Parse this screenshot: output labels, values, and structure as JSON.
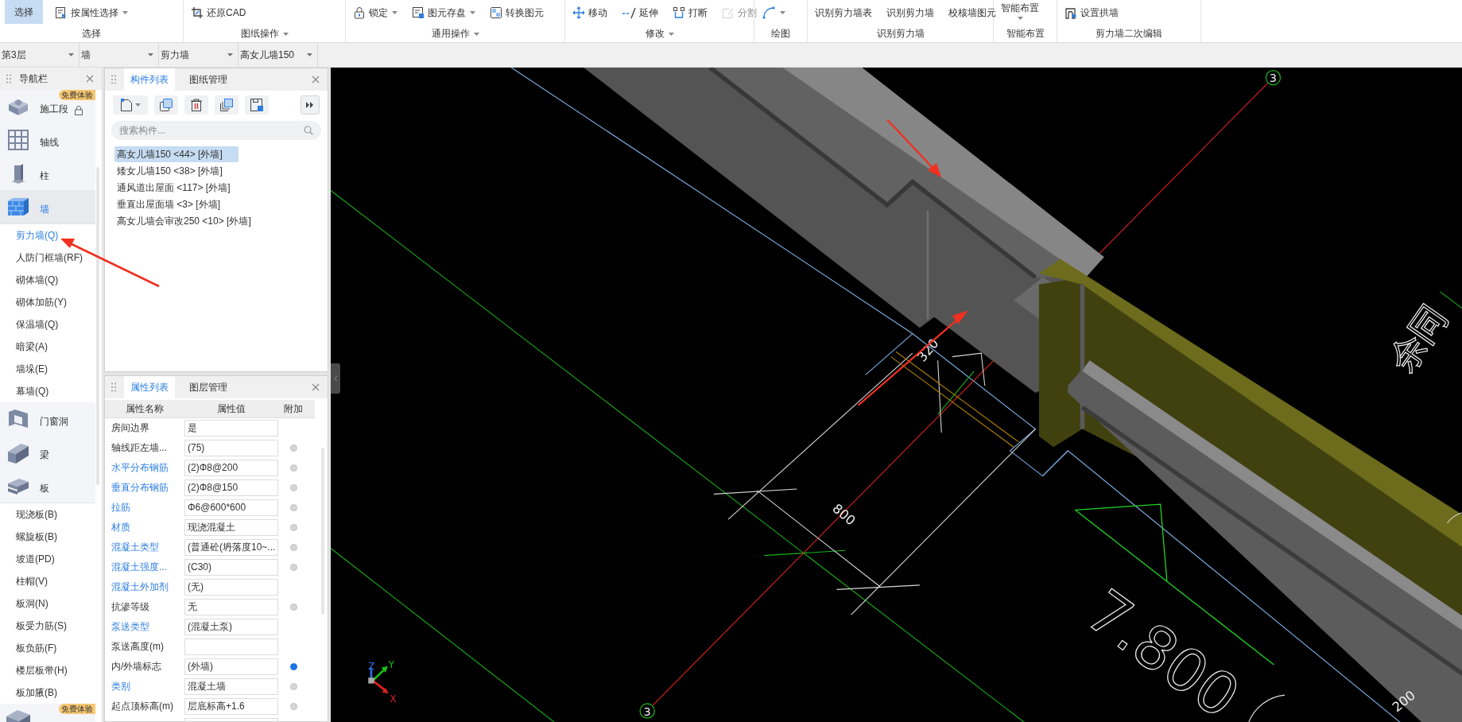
{
  "ribbon": {
    "groups": [
      {
        "label": "选择",
        "has_menu": false,
        "items": [
          {
            "kind": "big",
            "label": "选择",
            "selected": true,
            "disabled": false,
            "dropdown": false
          },
          {
            "kind": "small",
            "label": "按属性选择",
            "selected": false,
            "disabled": false,
            "dropdown": true
          }
        ]
      },
      {
        "label": "图纸操作",
        "has_menu": true,
        "items": [
          {
            "kind": "small",
            "label": "还原CAD",
            "selected": false,
            "disabled": false,
            "dropdown": false
          }
        ]
      },
      {
        "label": "通用操作",
        "has_menu": true,
        "items": [
          {
            "kind": "small",
            "label": "锁定",
            "selected": false,
            "disabled": false,
            "dropdown": true
          },
          {
            "kind": "small",
            "label": "图元存盘",
            "selected": false,
            "disabled": false,
            "dropdown": true
          },
          {
            "kind": "small",
            "label": "转换图元",
            "selected": false,
            "disabled": false,
            "dropdown": false
          }
        ]
      },
      {
        "label": "修改",
        "has_menu": true,
        "items": [
          {
            "kind": "small",
            "label": "移动",
            "selected": false,
            "disabled": false,
            "dropdown": false
          },
          {
            "kind": "small",
            "label": "延伸",
            "selected": false,
            "disabled": false,
            "dropdown": false
          },
          {
            "kind": "small",
            "label": "打断",
            "selected": false,
            "disabled": false,
            "dropdown": false
          },
          {
            "kind": "small",
            "label": "分割",
            "selected": false,
            "disabled": true,
            "dropdown": false
          }
        ]
      },
      {
        "label": "绘图",
        "has_menu": false,
        "items": [
          {
            "kind": "icon",
            "selected": false,
            "disabled": false,
            "dropdown": true
          }
        ]
      },
      {
        "label": "识别剪力墙",
        "has_menu": false,
        "items": [
          {
            "kind": "text",
            "label": "识别剪力墙表",
            "selected": false,
            "disabled": false,
            "dropdown": false
          },
          {
            "kind": "text",
            "label": "识别剪力墙",
            "selected": false,
            "disabled": false,
            "dropdown": false
          },
          {
            "kind": "text",
            "label": "校核墙图元",
            "selected": false,
            "disabled": false,
            "dropdown": false
          }
        ]
      },
      {
        "label": "智能布置",
        "has_menu": false,
        "items": [
          {
            "kind": "stacked",
            "label": "智能布置",
            "selected": false,
            "disabled": false,
            "dropdown": true
          }
        ]
      },
      {
        "label": "剪力墙二次编辑",
        "has_menu": false,
        "items": [
          {
            "kind": "small",
            "label": "设置拱墙",
            "selected": false,
            "disabled": false,
            "dropdown": false
          }
        ]
      }
    ]
  },
  "filters": [
    "第3层",
    "墙",
    "剪力墙",
    "高女儿墙150"
  ],
  "navigation": {
    "title": "导航栏",
    "items": [
      {
        "label": "施工段",
        "selected": false,
        "expanded": false,
        "badge": "免费体验",
        "locked": true
      },
      {
        "label": "轴线",
        "selected": false,
        "expanded": false
      },
      {
        "label": "柱",
        "selected": false,
        "expanded": false
      },
      {
        "label": "墙",
        "selected": true,
        "expanded": true,
        "children": [
          {
            "label": "剪力墙(Q)",
            "selected": true
          },
          {
            "label": "人防门框墙(RF)",
            "selected": false
          },
          {
            "label": "砌体墙(Q)",
            "selected": false
          },
          {
            "label": "砌体加筋(Y)",
            "selected": false
          },
          {
            "label": "保温墙(Q)",
            "selected": false
          },
          {
            "label": "暗梁(A)",
            "selected": false
          },
          {
            "label": "墙垛(E)",
            "selected": false
          },
          {
            "label": "幕墙(Q)",
            "selected": false
          }
        ]
      },
      {
        "label": "门窗洞",
        "selected": false,
        "expanded": false
      },
      {
        "label": "梁",
        "selected": false,
        "expanded": false
      },
      {
        "label": "板",
        "selected": false,
        "expanded": true,
        "children": [
          {
            "label": "现浇板(B)",
            "selected": false
          },
          {
            "label": "螺旋板(B)",
            "selected": false
          },
          {
            "label": "坡道(PD)",
            "selected": false
          },
          {
            "label": "柱帽(V)",
            "selected": false
          },
          {
            "label": "板洞(N)",
            "selected": false
          },
          {
            "label": "板受力筋(S)",
            "selected": false
          },
          {
            "label": "板负筋(F)",
            "selected": false
          },
          {
            "label": "楼层板带(H)",
            "selected": false
          },
          {
            "label": "板加腋(B)",
            "selected": false
          }
        ]
      },
      {
        "selected": false,
        "expanded": false,
        "badge": "免费体验"
      }
    ]
  },
  "component_panel": {
    "tabs": [
      {
        "label": "构件列表",
        "selected": true
      },
      {
        "label": "图纸管理",
        "selected": false
      }
    ],
    "search": {
      "placeholder": "搜索构件..."
    },
    "items": [
      {
        "label": "高女儿墙150 <44> [外墙]",
        "selected": true
      },
      {
        "label": "矮女儿墙150 <38> [外墙]",
        "selected": false
      },
      {
        "label": "通风道出屋面 <117> [外墙]",
        "selected": false
      },
      {
        "label": "垂直出屋面墙 <3> [外墙]",
        "selected": false
      },
      {
        "label": "高女儿墙会审改250 <10> [外墙]",
        "selected": false
      }
    ]
  },
  "property_panel": {
    "tabs": [
      {
        "label": "属性列表",
        "selected": true
      },
      {
        "label": "图层管理",
        "selected": false
      }
    ],
    "columns": [
      "属性名称",
      "属性值",
      "附加"
    ],
    "rows": [
      {
        "name": "房间边界",
        "value": "是",
        "public": false
      },
      {
        "name": "轴线距左墙...",
        "value": "(75)",
        "public": false,
        "attached": false
      },
      {
        "name": "水平分布钢筋",
        "value": "(2)Φ8@200",
        "public": true,
        "attached": false
      },
      {
        "name": "垂直分布钢筋",
        "value": "(2)Φ8@150",
        "public": true,
        "attached": false
      },
      {
        "name": "拉筋",
        "value": "Φ6@600*600",
        "public": true,
        "attached": false
      },
      {
        "name": "材质",
        "value": "现浇混凝土",
        "public": true,
        "attached": false
      },
      {
        "name": "混凝土类型",
        "value": "(普通砼(坍落度10~...",
        "public": true,
        "attached": false
      },
      {
        "name": "混凝土强度...",
        "value": "(C30)",
        "public": true,
        "attached": false
      },
      {
        "name": "混凝土外加剂",
        "value": "(无)",
        "public": true
      },
      {
        "name": "抗渗等级",
        "value": "无",
        "public": false,
        "attached": false
      },
      {
        "name": "泵送类型",
        "value": "(混凝土泵)",
        "public": true
      },
      {
        "name": "泵送高度(m)",
        "public": false
      },
      {
        "name": "内/外墙标志",
        "value": "(外墙)",
        "public": false,
        "attached": true
      },
      {
        "name": "类别",
        "value": "混凝土墙",
        "public": true,
        "attached": false
      },
      {
        "name": "起点顶标高(m)",
        "value": "层底标高+1.6",
        "public": false,
        "attached": false
      }
    ]
  },
  "canvas": {
    "axis_markers": [
      "3",
      "3"
    ],
    "dimension_labels": [
      "320",
      "800",
      "200"
    ],
    "elevation_label": "7.800",
    "note_text": "余同",
    "axes": [
      "X",
      "Y",
      "Z"
    ]
  }
}
